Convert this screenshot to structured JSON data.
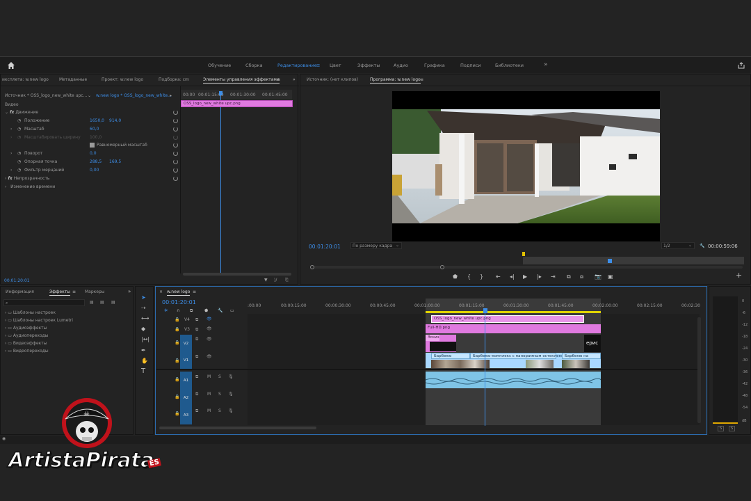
{
  "workspaces": [
    "Обучение",
    "Сборка",
    "Редактирование",
    "Цвет",
    "Эффекты",
    "Аудио",
    "Графика",
    "Подписи",
    "Библиотеки"
  ],
  "active_workspace": "Редактирование",
  "more_label": "»",
  "source_tabs": {
    "t1": "иксплета: w.new logo",
    "t2": "Метаданные",
    "t3": "Проект: w.new logo",
    "t4": "Подборка: cm",
    "t5": "Элементы управления эффектами"
  },
  "effect_controls": {
    "source": "Источник * OSS_logo_new_white upc...",
    "target": "w.new logo * OSS_logo_new_white...",
    "t_start": "00:00",
    "t_1": "00:01:15:00",
    "t_2": "00:01:30:00",
    "t_3": "00:01:45:00",
    "clip": "OSS_logo_new_white upc.png",
    "video": "Видео",
    "motion": "Движение",
    "pos_label": "Положение",
    "pos_x": "1650,0",
    "pos_y": "914,0",
    "scale_label": "Масштаб",
    "scale": "60,0",
    "scalew_label": "Масштабировать ширину",
    "scalew": "100,0",
    "uniform": "Равномерный масштаб",
    "rot_label": "Поворот",
    "rot": "0,0",
    "anchor_label": "Опорная точка",
    "anchor_x": "288,5",
    "anchor_y": "169,5",
    "flicker_label": "Фильтр мерцаний",
    "flicker": "0,00",
    "opacity": "Непрозрачность",
    "timeremap": "Изменение времени",
    "timecode": "00:01:20:01"
  },
  "monitor": {
    "source_tab": "Источник: (нет клипов)",
    "program_tab": "Программа: w.new logo",
    "timecode": "00:01:20:01",
    "fit": "По размеру кадра",
    "res": "1/2",
    "duration": "00:00:59:06"
  },
  "project": {
    "tab1": "Информация",
    "tab2": "Эффекты",
    "tab3": "Маркеры",
    "items": [
      "Шаблоны настроек",
      "Шаблоны настроек Lumetri",
      "Аудиоэффекты",
      "Аудиопереходы",
      "Видеоэффекты",
      "Видеопереходы"
    ]
  },
  "timeline": {
    "tab": "w.new logo",
    "timecode": "00:01:20:01",
    "ticks": [
      ":00:00",
      "00:00:15:00",
      "00:00:30:00",
      "00:00:45:00",
      "00:01:00:00",
      "00:01:15:00",
      "00:01:30:00",
      "00:01:45:00",
      "00:02:00:00",
      "00:02:15:00",
      "00:02:30"
    ],
    "tracks": [
      "V4",
      "V3",
      "V2",
      "V1",
      "A1",
      "A2",
      "A3"
    ],
    "clips": {
      "v4": "OSS_logo_new_white upc.png",
      "v3": "Full-HD.png",
      "v2": "Эскиз",
      "v1a": "Барбекю",
      "v1b": "Барбекю-комплекс с панорамным остеклением л",
      "v1c": "Барбекю на",
      "v2end": "ерис"
    }
  },
  "meter_labels": [
    "0",
    "-6",
    "-12",
    "-18",
    "-24",
    "-30",
    "-36",
    "-42",
    "-48",
    "-54",
    "dB"
  ],
  "meter_solo": [
    "S",
    "S"
  ],
  "watermark": "ArtistaPirata",
  "watermark_suffix": "ES"
}
